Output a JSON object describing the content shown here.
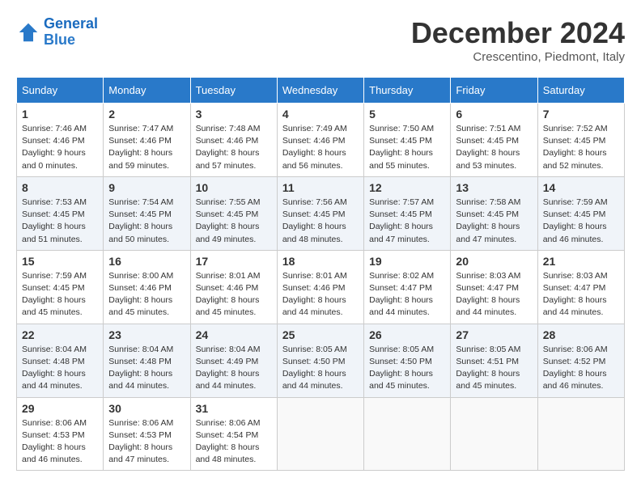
{
  "header": {
    "logo_line1": "General",
    "logo_line2": "Blue",
    "month_year": "December 2024",
    "location": "Crescentino, Piedmont, Italy"
  },
  "columns": [
    "Sunday",
    "Monday",
    "Tuesday",
    "Wednesday",
    "Thursday",
    "Friday",
    "Saturday"
  ],
  "weeks": [
    [
      {
        "day": "1",
        "sunrise": "7:46 AM",
        "sunset": "4:46 PM",
        "daylight": "9 hours and 0 minutes."
      },
      {
        "day": "2",
        "sunrise": "7:47 AM",
        "sunset": "4:46 PM",
        "daylight": "8 hours and 59 minutes."
      },
      {
        "day": "3",
        "sunrise": "7:48 AM",
        "sunset": "4:46 PM",
        "daylight": "8 hours and 57 minutes."
      },
      {
        "day": "4",
        "sunrise": "7:49 AM",
        "sunset": "4:46 PM",
        "daylight": "8 hours and 56 minutes."
      },
      {
        "day": "5",
        "sunrise": "7:50 AM",
        "sunset": "4:45 PM",
        "daylight": "8 hours and 55 minutes."
      },
      {
        "day": "6",
        "sunrise": "7:51 AM",
        "sunset": "4:45 PM",
        "daylight": "8 hours and 53 minutes."
      },
      {
        "day": "7",
        "sunrise": "7:52 AM",
        "sunset": "4:45 PM",
        "daylight": "8 hours and 52 minutes."
      }
    ],
    [
      {
        "day": "8",
        "sunrise": "7:53 AM",
        "sunset": "4:45 PM",
        "daylight": "8 hours and 51 minutes."
      },
      {
        "day": "9",
        "sunrise": "7:54 AM",
        "sunset": "4:45 PM",
        "daylight": "8 hours and 50 minutes."
      },
      {
        "day": "10",
        "sunrise": "7:55 AM",
        "sunset": "4:45 PM",
        "daylight": "8 hours and 49 minutes."
      },
      {
        "day": "11",
        "sunrise": "7:56 AM",
        "sunset": "4:45 PM",
        "daylight": "8 hours and 48 minutes."
      },
      {
        "day": "12",
        "sunrise": "7:57 AM",
        "sunset": "4:45 PM",
        "daylight": "8 hours and 47 minutes."
      },
      {
        "day": "13",
        "sunrise": "7:58 AM",
        "sunset": "4:45 PM",
        "daylight": "8 hours and 47 minutes."
      },
      {
        "day": "14",
        "sunrise": "7:59 AM",
        "sunset": "4:45 PM",
        "daylight": "8 hours and 46 minutes."
      }
    ],
    [
      {
        "day": "15",
        "sunrise": "7:59 AM",
        "sunset": "4:45 PM",
        "daylight": "8 hours and 45 minutes."
      },
      {
        "day": "16",
        "sunrise": "8:00 AM",
        "sunset": "4:46 PM",
        "daylight": "8 hours and 45 minutes."
      },
      {
        "day": "17",
        "sunrise": "8:01 AM",
        "sunset": "4:46 PM",
        "daylight": "8 hours and 45 minutes."
      },
      {
        "day": "18",
        "sunrise": "8:01 AM",
        "sunset": "4:46 PM",
        "daylight": "8 hours and 44 minutes."
      },
      {
        "day": "19",
        "sunrise": "8:02 AM",
        "sunset": "4:47 PM",
        "daylight": "8 hours and 44 minutes."
      },
      {
        "day": "20",
        "sunrise": "8:03 AM",
        "sunset": "4:47 PM",
        "daylight": "8 hours and 44 minutes."
      },
      {
        "day": "21",
        "sunrise": "8:03 AM",
        "sunset": "4:47 PM",
        "daylight": "8 hours and 44 minutes."
      }
    ],
    [
      {
        "day": "22",
        "sunrise": "8:04 AM",
        "sunset": "4:48 PM",
        "daylight": "8 hours and 44 minutes."
      },
      {
        "day": "23",
        "sunrise": "8:04 AM",
        "sunset": "4:48 PM",
        "daylight": "8 hours and 44 minutes."
      },
      {
        "day": "24",
        "sunrise": "8:04 AM",
        "sunset": "4:49 PM",
        "daylight": "8 hours and 44 minutes."
      },
      {
        "day": "25",
        "sunrise": "8:05 AM",
        "sunset": "4:50 PM",
        "daylight": "8 hours and 44 minutes."
      },
      {
        "day": "26",
        "sunrise": "8:05 AM",
        "sunset": "4:50 PM",
        "daylight": "8 hours and 45 minutes."
      },
      {
        "day": "27",
        "sunrise": "8:05 AM",
        "sunset": "4:51 PM",
        "daylight": "8 hours and 45 minutes."
      },
      {
        "day": "28",
        "sunrise": "8:06 AM",
        "sunset": "4:52 PM",
        "daylight": "8 hours and 46 minutes."
      }
    ],
    [
      {
        "day": "29",
        "sunrise": "8:06 AM",
        "sunset": "4:53 PM",
        "daylight": "8 hours and 46 minutes."
      },
      {
        "day": "30",
        "sunrise": "8:06 AM",
        "sunset": "4:53 PM",
        "daylight": "8 hours and 47 minutes."
      },
      {
        "day": "31",
        "sunrise": "8:06 AM",
        "sunset": "4:54 PM",
        "daylight": "8 hours and 48 minutes."
      },
      null,
      null,
      null,
      null
    ]
  ]
}
